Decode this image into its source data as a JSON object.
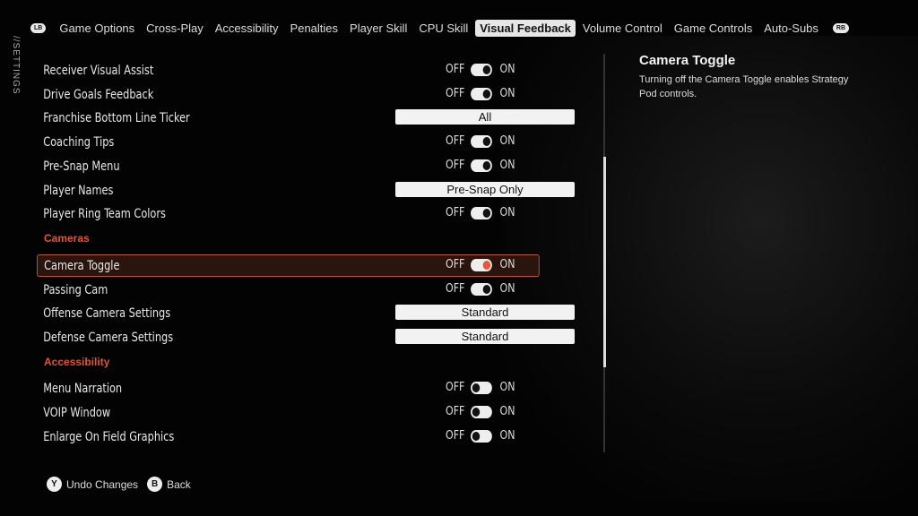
{
  "side_label": "//SETTINGS",
  "tabs": {
    "lb": "LB",
    "rb": "RB",
    "items": [
      "Game Options",
      "Cross-Play",
      "Accessibility",
      "Penalties",
      "Player Skill",
      "CPU Skill",
      "Visual Feedback",
      "Volume Control",
      "Game Controls",
      "Auto-Subs"
    ],
    "active": "Visual Feedback"
  },
  "toggle_labels": {
    "off": "OFF",
    "on": "ON"
  },
  "rows": [
    {
      "label": "Receiver Visual Assist",
      "type": "toggle",
      "value": "ON"
    },
    {
      "label": "Drive Goals Feedback",
      "type": "toggle",
      "value": "ON"
    },
    {
      "label": "Franchise Bottom Line Ticker",
      "type": "dropdown",
      "value": "All"
    },
    {
      "label": "Coaching Tips",
      "type": "toggle",
      "value": "ON"
    },
    {
      "label": "Pre-Snap Menu",
      "type": "toggle",
      "value": "ON"
    },
    {
      "label": "Player Names",
      "type": "dropdown",
      "value": "Pre-Snap Only"
    },
    {
      "label": "Player Ring Team Colors",
      "type": "toggle",
      "value": "ON"
    },
    {
      "section": "Cameras"
    },
    {
      "label": "Camera Toggle",
      "type": "toggle",
      "value": "ON",
      "selected": true
    },
    {
      "label": "Passing Cam",
      "type": "toggle",
      "value": "ON"
    },
    {
      "label": "Offense Camera Settings",
      "type": "dropdown",
      "value": "Standard"
    },
    {
      "label": "Defense Camera Settings",
      "type": "dropdown",
      "value": "Standard"
    },
    {
      "section": "Accessibility"
    },
    {
      "label": "Menu Narration",
      "type": "toggle",
      "value": "OFF"
    },
    {
      "label": "VOIP Window",
      "type": "toggle",
      "value": "OFF"
    },
    {
      "label": "Enlarge On Field Graphics",
      "type": "toggle",
      "value": "OFF"
    }
  ],
  "help": {
    "title": "Camera Toggle",
    "text": "Turning off the Camera Toggle enables Strategy Pod controls."
  },
  "footer": [
    {
      "button": "Y",
      "label": "Undo Changes"
    },
    {
      "button": "B",
      "label": "Back"
    }
  ],
  "colors": {
    "accent": "#e9553a",
    "selected_bg": "#2a140e"
  }
}
